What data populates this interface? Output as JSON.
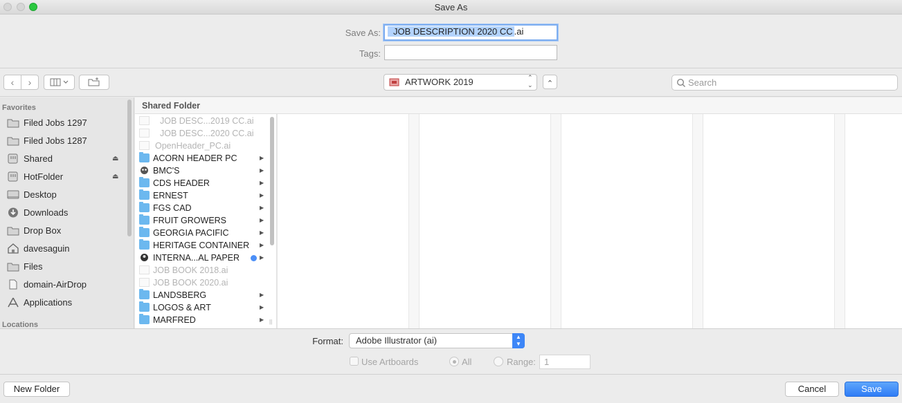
{
  "window": {
    "title": "Save As"
  },
  "save_as": {
    "label": "Save As:",
    "filename_selected": "JOB DESCRIPTION 2020 CC",
    "filename_ext": ".ai"
  },
  "tags": {
    "label": "Tags:",
    "value": ""
  },
  "location_popup": {
    "value": "ARTWORK 2019"
  },
  "search": {
    "placeholder": "Search"
  },
  "sidebar": {
    "favorites_heading": "Favorites",
    "locations_heading": "Locations",
    "items": [
      {
        "label": "Filed Jobs 1297",
        "icon": "folder-icon"
      },
      {
        "label": "Filed Jobs 1287",
        "icon": "folder-icon"
      },
      {
        "label": "Shared",
        "icon": "network-drive-icon",
        "eject": true
      },
      {
        "label": "HotFolder",
        "icon": "network-drive-icon",
        "eject": true
      },
      {
        "label": "Desktop",
        "icon": "desktop-icon"
      },
      {
        "label": "Downloads",
        "icon": "downloads-icon"
      },
      {
        "label": "Drop Box",
        "icon": "folder-icon"
      },
      {
        "label": "davesaguin",
        "icon": "home-icon"
      },
      {
        "label": "Files",
        "icon": "folder-icon"
      },
      {
        "label": "domain-AirDrop",
        "icon": "document-icon"
      },
      {
        "label": "Applications",
        "icon": "applications-icon"
      }
    ]
  },
  "browser": {
    "path_header": "Shared Folder",
    "files": [
      {
        "name": "JOB DESC...2019 CC.ai",
        "kind": "doc",
        "dim": true
      },
      {
        "name": "JOB DESC...2020 CC.ai",
        "kind": "doc",
        "dim": true
      },
      {
        "name": "OpenHeader_PC.ai",
        "kind": "doc",
        "dim": true
      },
      {
        "name": "ACORN HEADER PC",
        "kind": "folder"
      },
      {
        "name": "BMC'S",
        "kind": "custom"
      },
      {
        "name": "CDS HEADER",
        "kind": "folder"
      },
      {
        "name": "ERNEST",
        "kind": "folder"
      },
      {
        "name": "FGS CAD",
        "kind": "folder"
      },
      {
        "name": "FRUIT GROWERS",
        "kind": "folder"
      },
      {
        "name": "GEORGIA PACIFIC",
        "kind": "folder"
      },
      {
        "name": "HERITAGE CONTAINER",
        "kind": "folder"
      },
      {
        "name": "INTERNA...AL PAPER",
        "kind": "custom",
        "tag_color": "#4c8ff7"
      },
      {
        "name": "JOB BOOK 2018.ai",
        "kind": "doc",
        "dim": true
      },
      {
        "name": "JOB BOOK 2020.ai",
        "kind": "doc",
        "dim": true
      },
      {
        "name": "LANDSBERG",
        "kind": "folder"
      },
      {
        "name": "LOGOS & ART",
        "kind": "folder"
      },
      {
        "name": "MARFRED",
        "kind": "folder"
      }
    ]
  },
  "format": {
    "label": "Format:",
    "value": "Adobe Illustrator (ai)"
  },
  "artboards": {
    "use_label": "Use Artboards",
    "all_label": "All",
    "range_label": "Range:",
    "range_value": "1"
  },
  "buttons": {
    "new_folder": "New Folder",
    "cancel": "Cancel",
    "save": "Save"
  },
  "colors": {
    "accent": "#2f7cf6",
    "folder": "#6cb8ef",
    "selection": "#b3d3fd"
  }
}
